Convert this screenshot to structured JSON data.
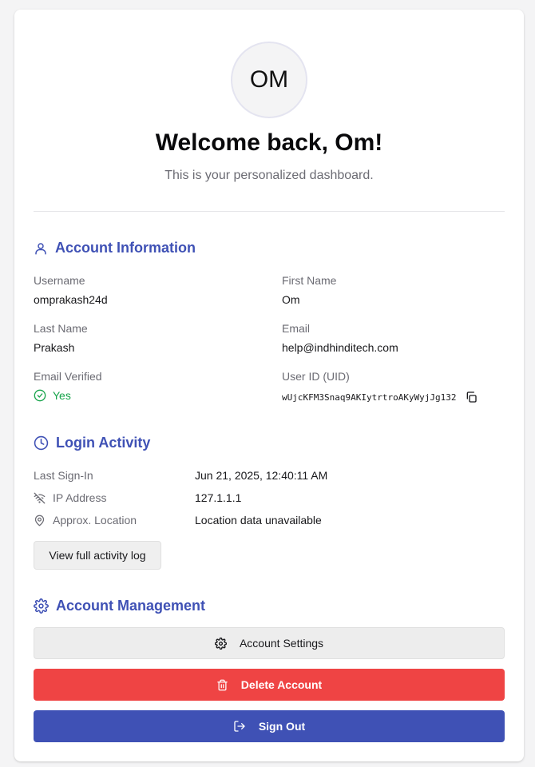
{
  "profile": {
    "initials": "OM",
    "welcome": "Welcome back, Om!",
    "subtitle": "This is your personalized dashboard."
  },
  "account_info": {
    "title": "Account Information",
    "username_label": "Username",
    "username": "omprakash24d",
    "first_name_label": "First Name",
    "first_name": "Om",
    "last_name_label": "Last Name",
    "last_name": "Prakash",
    "email_label": "Email",
    "email": "help@indhinditech.com",
    "email_verified_label": "Email Verified",
    "email_verified": "Yes",
    "uid_label": "User ID (UID)",
    "uid": "wUjcKFM3Snaq9AKIytrtroAKyWyjJg132"
  },
  "login_activity": {
    "title": "Login Activity",
    "last_signin_label": "Last Sign-In",
    "last_signin": "Jun 21, 2025, 12:40:11 AM",
    "ip_label": "IP Address",
    "ip": "127.1.1.1",
    "location_label": "Approx. Location",
    "location": "Location data unavailable",
    "log_button": "View full activity log"
  },
  "management": {
    "title": "Account Management",
    "settings_button": "Account Settings",
    "delete_button": "Delete Account",
    "signout_button": "Sign Out"
  },
  "colors": {
    "accent": "#3f51b5",
    "danger": "#ef4444",
    "success": "#16a34a"
  }
}
